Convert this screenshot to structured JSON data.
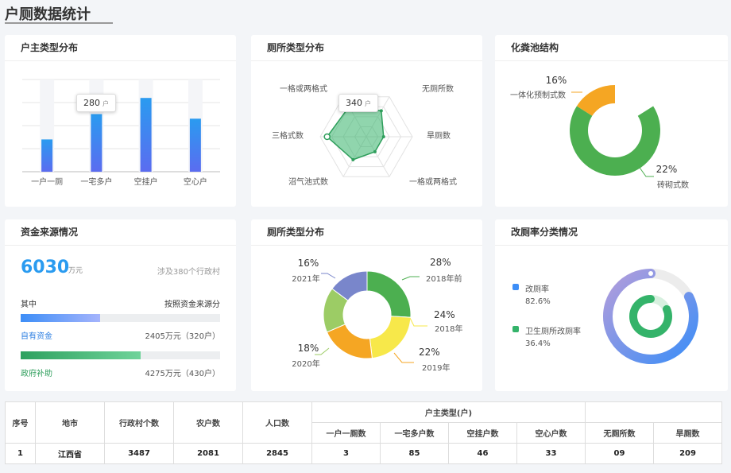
{
  "page": {
    "title": "户厕数据统计"
  },
  "cards": {
    "owner_type": {
      "title": "户主类型分布"
    },
    "toilet_type_radar": {
      "title": "厕所类型分布"
    },
    "septic_tank": {
      "title": "化粪池结构"
    },
    "funding": {
      "title": "资金来源情况"
    },
    "toilet_type_donut": {
      "title": "厕所类型分布"
    },
    "renovation_rate": {
      "title": "改厕率分类情况"
    }
  },
  "owner_tooltip": {
    "value": "280",
    "unit": "户"
  },
  "radar_tooltip": {
    "value": "340",
    "unit": "户"
  },
  "funding": {
    "total": "6030",
    "total_unit": "万元",
    "note": "涉及380个行政村",
    "breakdown_label": "其中",
    "breakdown_right": "按照资金来源分",
    "items": [
      {
        "label": "自有资金",
        "amount": "2405万元（320户）",
        "fraction": 0.4,
        "color": "#4a90e2"
      },
      {
        "label": "政府补助",
        "amount": "4275万元（430户）",
        "fraction": 0.6,
        "color": "#34b36a"
      }
    ]
  },
  "renovation": {
    "legend": [
      {
        "label": "改厕率",
        "value": "82.6%",
        "color": "#3d8ef7"
      },
      {
        "label": "卫生厕所改厕率",
        "value": "36.4%",
        "color": "#34b36a"
      }
    ]
  },
  "chart_data": [
    {
      "type": "bar",
      "title": "户主类型分布",
      "categories": [
        "一户一厕",
        "一宅多户",
        "空挂户",
        "空心户"
      ],
      "values": [
        140,
        250,
        320,
        230
      ],
      "ylim": [
        0,
        400
      ],
      "grid": true,
      "colors": [
        "#2a9bf0",
        "#5b6cf0"
      ]
    },
    {
      "type": "radar",
      "title": "厕所类型分布",
      "categories": [
        "无厕所数",
        "旱厕数",
        "一格或两格式",
        "沼气池式数",
        "三格式数",
        "一格或两格式"
      ],
      "values": [
        300,
        260,
        150,
        150,
        230,
        340
      ],
      "max": 400,
      "color": "#34b36a"
    },
    {
      "type": "pie",
      "title": "化粪池结构",
      "series": [
        {
          "name": "一体化预制式数",
          "value": 16,
          "label": "16%",
          "color": "#f5a623"
        },
        {
          "name": "砖砌式数",
          "value": 84,
          "label": "22%",
          "color": "#4caf50"
        }
      ]
    },
    {
      "type": "pie",
      "title": "厕所类型分布",
      "series": [
        {
          "name": "2018年前",
          "value": 28,
          "label": "28%",
          "color": "#4caf50"
        },
        {
          "name": "2018年",
          "value": 24,
          "label": "24%",
          "color": "#f7e84a"
        },
        {
          "name": "2019年",
          "value": 22,
          "label": "22%",
          "color": "#f5a623"
        },
        {
          "name": "2020年",
          "value": 18,
          "label": "18%",
          "color": "#9ccc65"
        },
        {
          "name": "2021年",
          "value": 16,
          "label": "16%",
          "color": "#7986cb"
        }
      ]
    }
  ],
  "table": {
    "headers": [
      "序号",
      "地市",
      "行政村个数",
      "农户数",
      "人口数"
    ],
    "group_header": "户主类型(户)",
    "sub_headers": [
      "一户一厕数",
      "一宅多户数",
      "空挂户数",
      "空心户数"
    ],
    "extra_headers": [
      "无厕所数",
      "旱厕数"
    ],
    "row": [
      "1",
      "江西省",
      "3487",
      "2081",
      "2845",
      "3",
      "85",
      "46",
      "33",
      "09",
      "209"
    ]
  }
}
